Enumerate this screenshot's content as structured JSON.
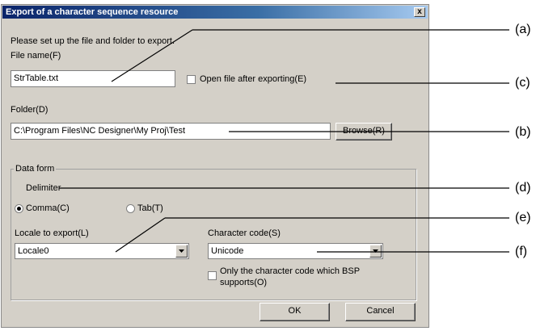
{
  "dialog": {
    "title": "Export of a character sequence resource",
    "close_label": "x",
    "instruction": "Please set up the file and folder to export.",
    "file_name_label": "File name(F)",
    "file_name_value": "StrTable.txt",
    "open_after_export_label": "Open file after exporting(E)",
    "folder_label": "Folder(D)",
    "folder_value": "C:\\Program Files\\NC Designer\\My Proj\\Test",
    "browse_label": "Browse(R)",
    "data_form_label": "Data form",
    "delimiter_label": "Delimiter",
    "comma_label": "Comma(C)",
    "tab_label": "Tab(T)",
    "locale_label": "Locale to export(L)",
    "locale_value": "Locale0",
    "charcode_label": "Character code(S)",
    "charcode_value": "Unicode",
    "bsp_only_label_1": "Only the character code which BSP",
    "bsp_only_label_2": "supports(O)",
    "ok_label": "OK",
    "cancel_label": "Cancel"
  },
  "callouts": {
    "a": "(a)",
    "b": "(b)",
    "c": "(c)",
    "d": "(d)",
    "e": "(e)",
    "f": "(f)"
  }
}
